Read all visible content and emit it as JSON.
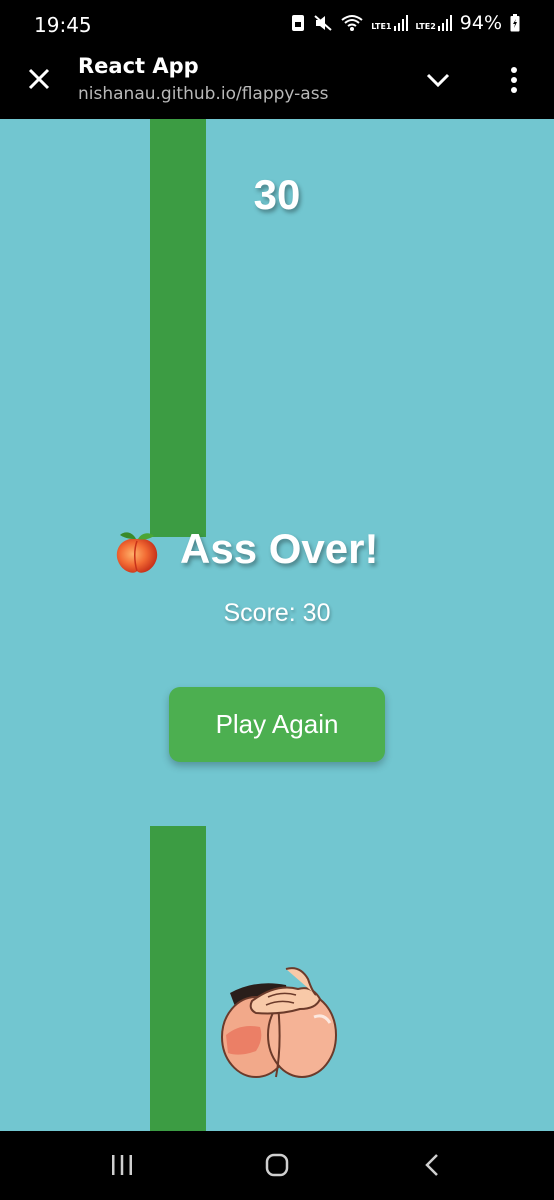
{
  "status_bar": {
    "time": "19:45",
    "battery": "94%",
    "sim1": "LTE1",
    "sim2": "LTE2",
    "icons": [
      "lock-icon",
      "mute-icon",
      "wifi-icon",
      "signal-icon",
      "signal-icon",
      "battery-icon"
    ]
  },
  "browser": {
    "title": "React App",
    "url": "nishanau.github.io/flappy-ass",
    "icons": [
      "close-icon",
      "chevron-down-icon",
      "more-vert-icon"
    ]
  },
  "game": {
    "score": "30",
    "game_over_title": "Ass Over!",
    "final_score_text": "Score: 30",
    "play_again_label": "Play Again",
    "icons": [
      "peach-icon",
      "player-sprite"
    ],
    "colors": {
      "sky": "#72c6d0",
      "pipe": "#3c9c43",
      "button": "#4caf50"
    }
  },
  "navigation": {
    "icons": [
      "recents-icon",
      "home-icon",
      "back-icon"
    ]
  }
}
